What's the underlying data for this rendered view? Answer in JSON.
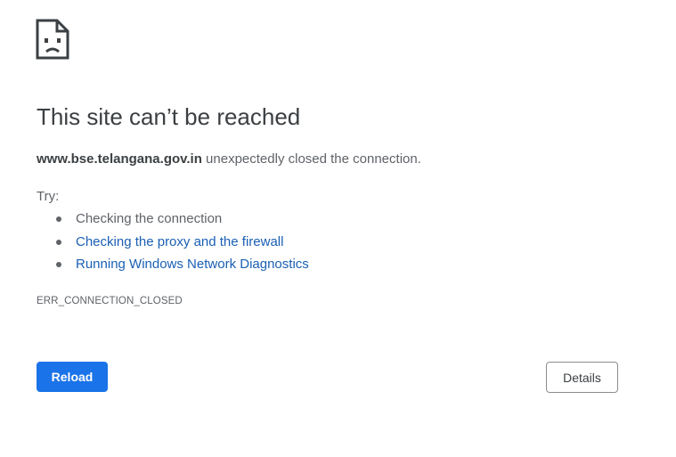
{
  "icon": "sad-page-icon",
  "title": "This site can’t be reached",
  "message": {
    "host": "www.bse.telangana.gov.in",
    "text": " unexpectedly closed the connection."
  },
  "try_label": "Try:",
  "suggestions": [
    {
      "label": "Checking the connection",
      "is_link": false
    },
    {
      "label": "Checking the proxy and the firewall",
      "is_link": true
    },
    {
      "label": "Running Windows Network Diagnostics",
      "is_link": true
    }
  ],
  "error_code": "ERR_CONNECTION_CLOSED",
  "buttons": {
    "reload": "Reload",
    "details": "Details"
  },
  "colors": {
    "primary": "#1a73e8",
    "link": "#1a5fb4",
    "heading": "#3c4043",
    "text": "#5f6368"
  }
}
